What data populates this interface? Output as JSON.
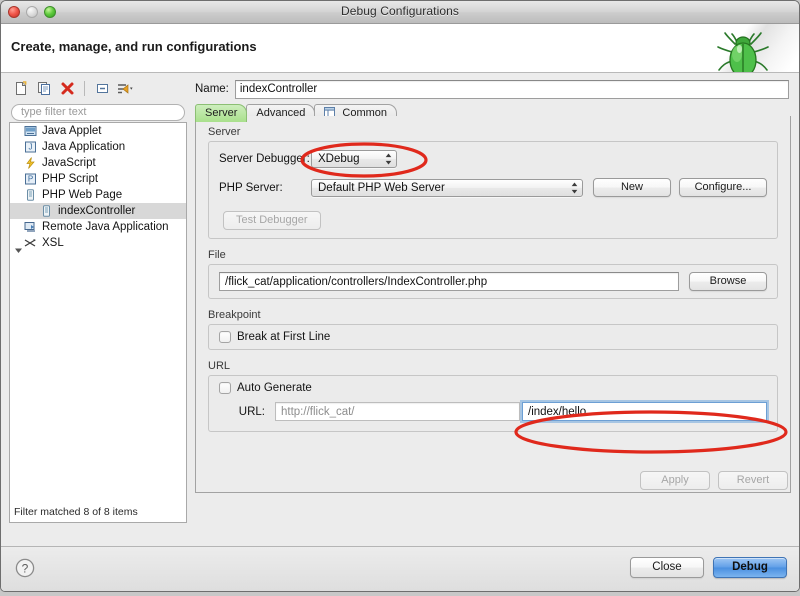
{
  "window": {
    "title": "Debug Configurations",
    "banner_title": "Create, manage, and run configurations",
    "bug_icon": "green-bug-icon"
  },
  "traffic_lights": {
    "close": "close-window-button",
    "minimize": "minimize-window-button",
    "zoom": "zoom-window-button"
  },
  "sidebar": {
    "toolbar": [
      {
        "name": "new-launch-configuration-icon",
        "title": "New launch configuration"
      },
      {
        "name": "duplicate-launch-configuration-icon",
        "title": "Duplicate"
      },
      {
        "name": "delete-launch-configuration-icon",
        "title": "Delete"
      },
      {
        "name": "collapse-all-icon",
        "title": "Collapse All"
      },
      {
        "name": "filter-launch-configurations-icon",
        "title": "Filter"
      }
    ],
    "filter_placeholder": "type filter text",
    "filter_value": "",
    "tree": [
      {
        "label": "Java Applet",
        "icon": "java-applet-icon",
        "level": 0,
        "selected": false,
        "expander": "none"
      },
      {
        "label": "Java Application",
        "icon": "java-application-icon",
        "level": 0,
        "selected": false,
        "expander": "none"
      },
      {
        "label": "JavaScript",
        "icon": "javascript-icon",
        "level": 0,
        "selected": false,
        "expander": "none"
      },
      {
        "label": "PHP Script",
        "icon": "php-script-icon",
        "level": 0,
        "selected": false,
        "expander": "none"
      },
      {
        "label": "PHP Web Page",
        "icon": "php-web-page-icon",
        "level": 0,
        "selected": false,
        "expander": "expanded"
      },
      {
        "label": "indexController",
        "icon": "php-web-page-config-icon",
        "level": 1,
        "selected": true,
        "expander": "none"
      },
      {
        "label": "Remote Java Application",
        "icon": "remote-java-application-icon",
        "level": 0,
        "selected": false,
        "expander": "none"
      },
      {
        "label": "XSL",
        "icon": "xsl-icon",
        "level": 0,
        "selected": false,
        "expander": "none"
      }
    ],
    "status": "Filter matched 8 of 8 items"
  },
  "config": {
    "name_label": "Name:",
    "name_value": "indexController",
    "tabs": [
      {
        "label": "Server",
        "active": true,
        "icon": null
      },
      {
        "label": "Advanced",
        "active": false,
        "icon": null
      },
      {
        "label": "Common",
        "active": false,
        "icon": "common-tab-icon"
      }
    ],
    "server_group": {
      "title": "Server",
      "debugger_label": "Server Debugger:",
      "debugger_value": "XDebug",
      "php_server_label": "PHP Server:",
      "php_server_value": "Default PHP Web Server",
      "new_button": "New",
      "configure_button": "Configure...",
      "test_debugger_button": "Test Debugger",
      "test_debugger_enabled": false
    },
    "file_group": {
      "title": "File",
      "path": "/flick_cat/application/controllers/IndexController.php",
      "browse_button": "Browse"
    },
    "breakpoint_group": {
      "title": "Breakpoint",
      "break_at_first_line_label": "Break at First Line",
      "break_at_first_line_checked": false
    },
    "url_group": {
      "title": "URL",
      "auto_generate_label": "Auto Generate",
      "auto_generate_checked": false,
      "url_label": "URL:",
      "base_url": "http://flick_cat/",
      "path_value": "/index/hello"
    },
    "apply_button": "Apply",
    "revert_button": "Revert",
    "apply_enabled": false,
    "revert_enabled": false
  },
  "footer": {
    "help_icon": "help-icon",
    "close_button": "Close",
    "debug_button": "Debug"
  },
  "annotations": {
    "color": "#e0291c",
    "shapes": [
      {
        "name": "annotation-ellipse-server-debugger",
        "target": "server-debugger-dropdown"
      },
      {
        "name": "annotation-ellipse-url-path",
        "target": "url-path-input"
      }
    ]
  }
}
